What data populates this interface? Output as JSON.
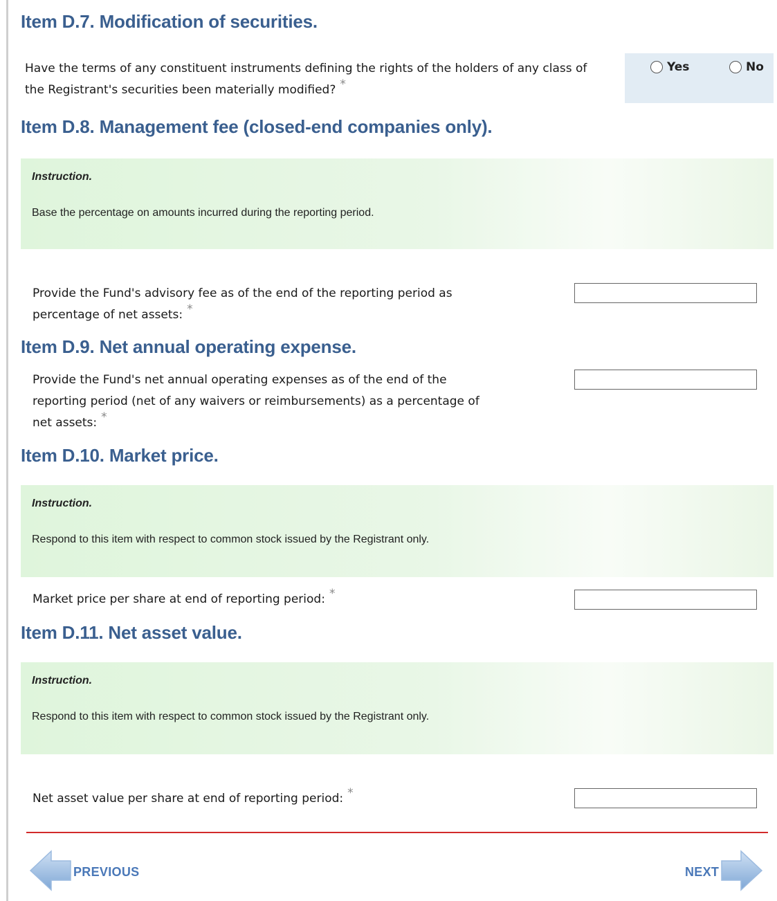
{
  "items": {
    "d7": {
      "heading": "Item D.7. Modification of securities.",
      "question_line1": "Have the terms of any constituent instruments defining the rights of the holders of any class of",
      "question_line2": "the Registrant's securities been materially modified?",
      "required_mark": "*",
      "options": {
        "yes": "Yes",
        "no": "No"
      }
    },
    "d8": {
      "heading": "Item D.8. Management fee (closed-end companies only).",
      "instruction_title": "Instruction.",
      "instruction_body": "Base the percentage on amounts incurred during the reporting period.",
      "question_line1": "Provide the Fund's advisory fee as of the end of the reporting period as",
      "question_line2": "percentage of net assets:",
      "required_mark": "*",
      "value": ""
    },
    "d9": {
      "heading": "Item D.9. Net annual operating expense.",
      "question_line1": "Provide the Fund's net annual operating expenses as of the end of the",
      "question_line2": "reporting period (net of any waivers or reimbursements) as a percentage of",
      "question_line3": "net assets:",
      "required_mark": "*",
      "value": ""
    },
    "d10": {
      "heading": "Item D.10. Market price.",
      "instruction_title": "Instruction.",
      "instruction_body": "Respond to this item with respect to common stock issued by the Registrant only.",
      "question": "Market price per share at end of reporting period:",
      "required_mark": "*",
      "value": ""
    },
    "d11": {
      "heading": "Item D.11. Net asset value.",
      "instruction_title": "Instruction.",
      "instruction_body": "Respond to this item with respect to common stock issued by the Registrant only.",
      "question": "Net asset value per share at end of reporting period:",
      "required_mark": "*",
      "value": ""
    }
  },
  "navigation": {
    "previous_label": "PREVIOUS",
    "next_label": "NEXT"
  },
  "colors": {
    "heading": "#3a5f8f",
    "instruction_bg": "#dff5dc",
    "radio_panel_bg": "#e2ecf4",
    "divider": "#d22a2a",
    "nav_arrow": "#8fb4dd",
    "nav_text": "#4a78b8"
  }
}
